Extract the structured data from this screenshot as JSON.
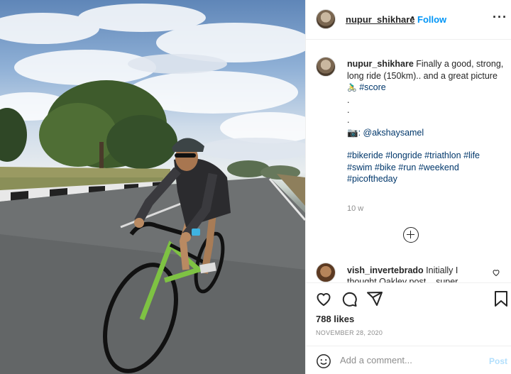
{
  "post": {
    "photo_alt": "cyclist-photo",
    "header": {
      "username": "nupur_shikhare",
      "dot": "•",
      "follow_label": "Follow",
      "more_icon": "more-options-icon"
    },
    "caption": {
      "username": "nupur_shikhare",
      "text": "Finally a good, strong, long ride (150km).. and a great picture",
      "emoji": "🚴‍♂️",
      "tag_score": "#score",
      "dots": [
        ".",
        ".",
        "."
      ],
      "camera_emoji": "📷",
      "credit": ": @akshaysamel",
      "tags": [
        "#bikeride",
        "#longride",
        "#triathlon",
        "#life",
        "#swim",
        "#bike",
        "#run",
        "#weekend",
        "#picoftheday"
      ],
      "time": "10 w"
    },
    "comment": {
      "username": "vish_invertebrado",
      "text": "Initially I thought Oakley post... super"
    },
    "likes": "788 likes",
    "date": "NOVEMBER 28, 2020",
    "add_comment_placeholder": "Add a comment...",
    "post_label": "Post"
  }
}
